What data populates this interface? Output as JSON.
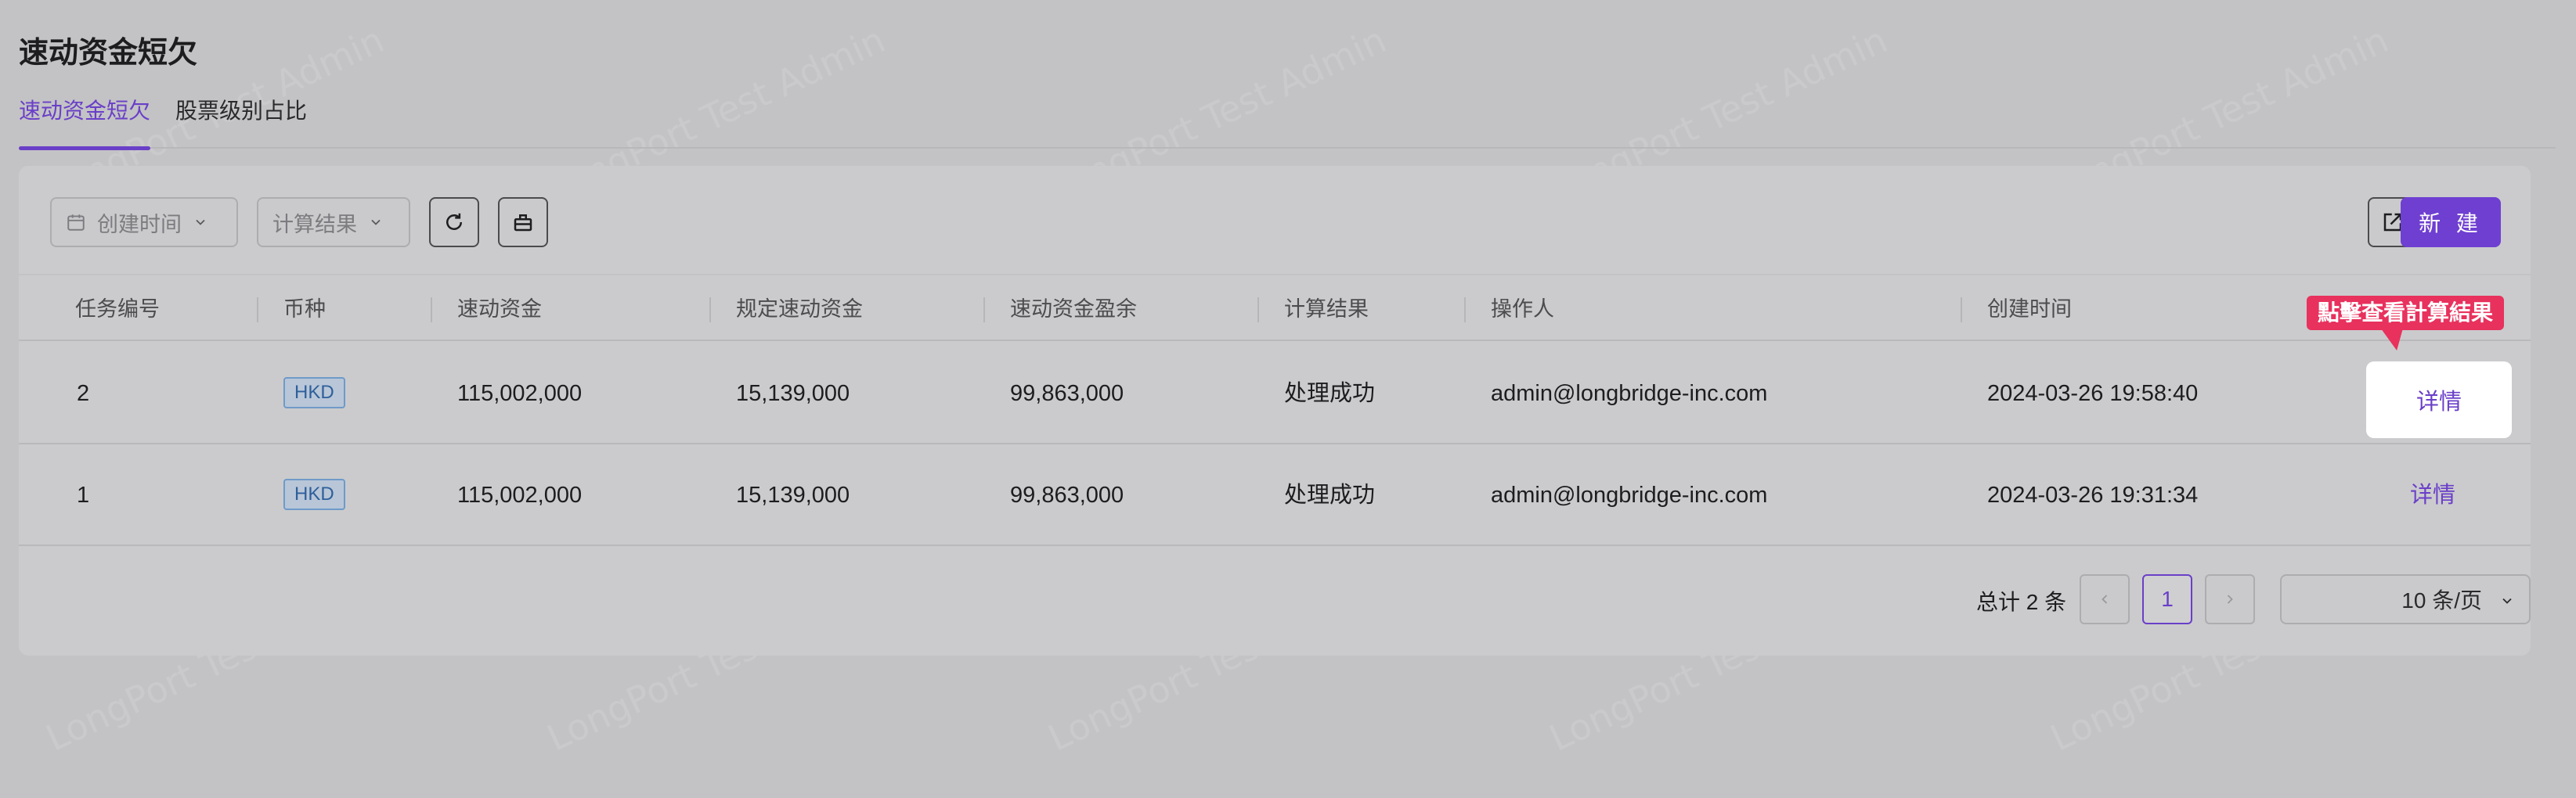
{
  "page": {
    "title": "速动资金短欠"
  },
  "tabs": [
    {
      "label": "速动资金短欠",
      "active": true
    },
    {
      "label": "股票级别占比",
      "active": false
    }
  ],
  "toolbar": {
    "date_filter_placeholder": "创建时间",
    "result_filter_placeholder": "计算结果",
    "refresh_icon": "refresh-icon",
    "clear_icon": "clear-filter-icon",
    "export_icon": "export-icon",
    "new_label": "新 建"
  },
  "table": {
    "columns": [
      "任务编号",
      "币种",
      "速动资金",
      "规定速动资金",
      "速动资金盈余",
      "计算结果",
      "操作人",
      "创建时间"
    ],
    "rows": [
      {
        "id": "2",
        "currency": "HKD",
        "liquid_capital": "115,002,000",
        "required_liquid_capital": "15,139,000",
        "surplus": "99,863,000",
        "result": "处理成功",
        "operator": "admin@longbridge-inc.com",
        "created_at": "2024-03-26 19:58:40",
        "action": "详情"
      },
      {
        "id": "1",
        "currency": "HKD",
        "liquid_capital": "115,002,000",
        "required_liquid_capital": "15,139,000",
        "surplus": "99,863,000",
        "result": "处理成功",
        "operator": "admin@longbridge-inc.com",
        "created_at": "2024-03-26 19:31:34",
        "action": "详情"
      }
    ]
  },
  "annotation": {
    "callout": "點擊查看計算結果"
  },
  "pagination": {
    "total": "总计 2 条",
    "current_page": "1",
    "page_size": "10 条/页",
    "prev_icon": "chevron-left-icon",
    "next_icon": "chevron-right-icon"
  },
  "watermark": "LongPort Test Admin",
  "colors": {
    "accent": "#6a3fc8",
    "callout": "#e8315d",
    "tag_border": "#6e9ac8"
  }
}
